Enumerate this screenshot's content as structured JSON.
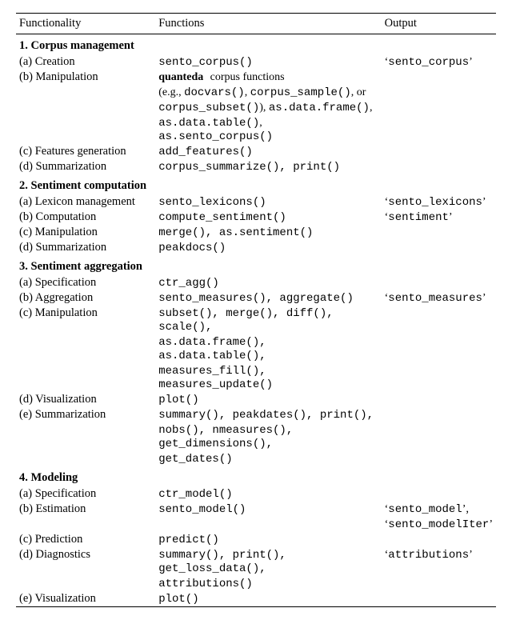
{
  "headers": {
    "c1": "Functionality",
    "c2": "Functions",
    "c3": "Output"
  },
  "sections": [
    {
      "title": "1. Corpus management",
      "rows": [
        {
          "label": "(a) Creation",
          "funcs": [
            "sento_corpus()"
          ],
          "out": [
            "sento_corpus"
          ]
        },
        {
          "label": "(b) Manipulation",
          "funcs_raw": [
            "<b class='serif'>quanteda</b> <span class='serif'>corpus functions</span>",
            "<span class='serif'>(e.g., </span>docvars()<span class='serif'>, </span>corpus_sample()<span class='serif'>, or</span>",
            "corpus_subset()<span class='serif'>), </span>as.data.frame()<span class='serif'>,</span>",
            "as.data.table()<span class='serif'>, </span>as.sento_corpus()"
          ],
          "out": []
        },
        {
          "label": "(c) Features generation",
          "funcs": [
            "add_features()"
          ],
          "out": []
        },
        {
          "label": "(d) Summarization",
          "funcs": [
            "corpus_summarize(), print()"
          ],
          "out": []
        }
      ]
    },
    {
      "title": "2. Sentiment computation",
      "rows": [
        {
          "label": "(a) Lexicon management",
          "funcs": [
            "sento_lexicons()"
          ],
          "out": [
            "sento_lexicons"
          ]
        },
        {
          "label": "(b) Computation",
          "funcs": [
            "compute_sentiment()"
          ],
          "out": [
            "sentiment"
          ]
        },
        {
          "label": "(c) Manipulation",
          "funcs": [
            "merge(), as.sentiment()"
          ],
          "out": []
        },
        {
          "label": "(d) Summarization",
          "funcs": [
            "peakdocs()"
          ],
          "out": []
        }
      ]
    },
    {
      "title": "3. Sentiment aggregation",
      "rows": [
        {
          "label": "(a) Specification",
          "funcs": [
            "ctr_agg()"
          ],
          "out": []
        },
        {
          "label": "(b) Aggregation",
          "funcs": [
            "sento_measures(), aggregate()"
          ],
          "out": [
            "sento_measures"
          ]
        },
        {
          "label": "(c) Manipulation",
          "funcs": [
            "subset(), merge(), diff(), scale(),",
            "as.data.frame(), as.data.table(),",
            "measures_fill(), measures_update()"
          ],
          "out": []
        },
        {
          "label": "(d) Visualization",
          "funcs": [
            "plot()"
          ],
          "out": []
        },
        {
          "label": "(e) Summarization",
          "funcs": [
            "summary(), peakdates(), print(),",
            "nobs(), nmeasures(), get_dimensions(),",
            "get_dates()"
          ],
          "out": []
        }
      ]
    },
    {
      "title": "4. Modeling",
      "rows": [
        {
          "label": "(a) Specification",
          "funcs": [
            "ctr_model()"
          ],
          "out": []
        },
        {
          "label": "(b) Estimation",
          "funcs": [
            "sento_model()"
          ],
          "out": [
            "sento_model",
            "sento_modelIter"
          ]
        },
        {
          "label": "(c) Prediction",
          "funcs": [
            "predict()"
          ],
          "out": []
        },
        {
          "label": "(d) Diagnostics",
          "funcs": [
            "summary(), print(), get_loss_data(),",
            "attributions()"
          ],
          "out": [
            "attributions"
          ]
        },
        {
          "label": "(e) Visualization",
          "funcs": [
            "plot()"
          ],
          "out": []
        }
      ]
    }
  ]
}
